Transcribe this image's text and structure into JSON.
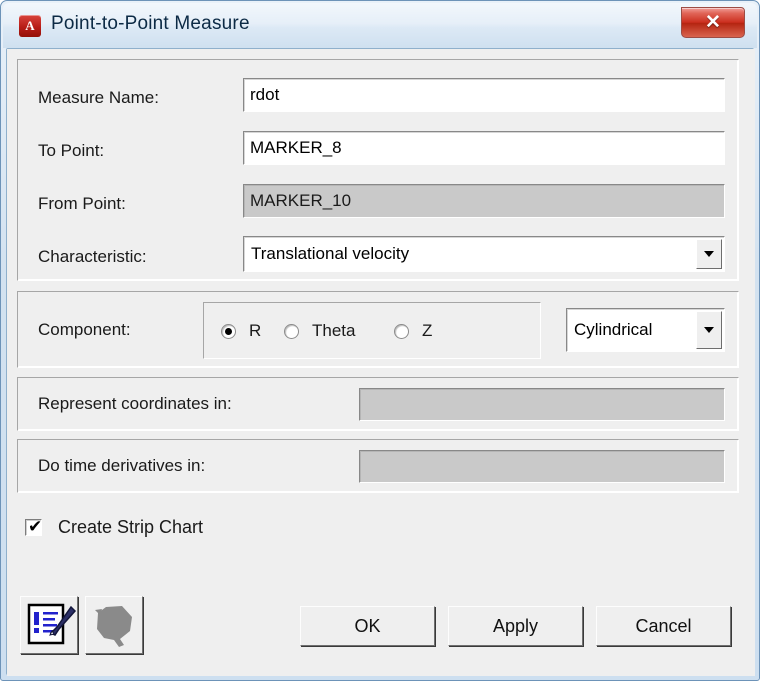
{
  "window": {
    "title": "Point-to-Point Measure",
    "app_icon_letter": "A",
    "close_label": "✕",
    "accent_close": "#cc2e1e",
    "titlebar_color": "#dce9f5",
    "client_color": "#efefef"
  },
  "form": {
    "rows": [
      {
        "label": "Measure Name:",
        "value": "rdot",
        "enabled": true,
        "kind": "text"
      },
      {
        "label": "To Point:",
        "value": "MARKER_8",
        "enabled": true,
        "kind": "text"
      },
      {
        "label": "From Point:",
        "value": "MARKER_10",
        "enabled": false,
        "kind": "text"
      },
      {
        "label": "Characteristic:",
        "value": "Translational velocity",
        "enabled": true,
        "kind": "combo"
      }
    ]
  },
  "component": {
    "label": "Component:",
    "options": [
      {
        "label": "R",
        "selected": true
      },
      {
        "label": "Theta",
        "selected": false
      },
      {
        "label": "Z",
        "selected": false
      }
    ],
    "coordinate_system": "Cylindrical"
  },
  "represent": {
    "label": "Represent coordinates in:",
    "value": "",
    "enabled": false
  },
  "derivatives": {
    "label": "Do time derivatives in:",
    "value": "",
    "enabled": false
  },
  "strip_chart": {
    "label": "Create Strip Chart",
    "checked": true,
    "tick": "✔"
  },
  "icon_buttons": [
    {
      "name": "edit-form-icon",
      "enabled": true
    },
    {
      "name": "geometry-pick-icon",
      "enabled": false
    }
  ],
  "buttons": {
    "ok": "OK",
    "apply": "Apply",
    "cancel": "Cancel"
  }
}
